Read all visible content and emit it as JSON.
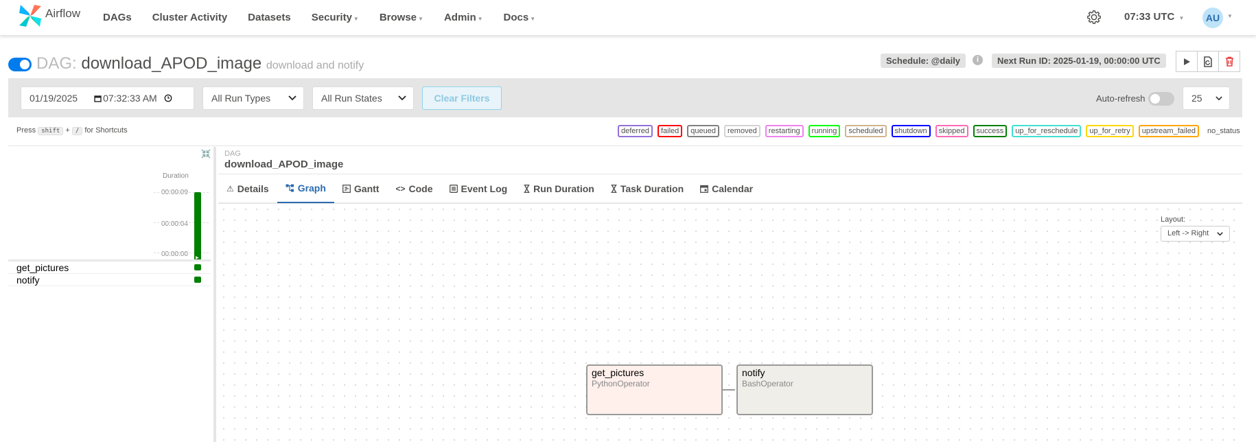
{
  "nav": {
    "brand": "Airflow",
    "items": [
      {
        "label": "DAGs",
        "caret": false
      },
      {
        "label": "Cluster Activity",
        "caret": false
      },
      {
        "label": "Datasets",
        "caret": false
      },
      {
        "label": "Security",
        "caret": true
      },
      {
        "label": "Browse",
        "caret": true
      },
      {
        "label": "Admin",
        "caret": true
      },
      {
        "label": "Docs",
        "caret": true
      }
    ],
    "time": "07:33 UTC",
    "avatar": "AU"
  },
  "dag": {
    "prefix": "DAG:",
    "id": "download_APOD_image",
    "description": "download and notify",
    "schedule": "Schedule: @daily",
    "next_run": "Next Run ID: 2025-01-19, 00:00:00 UTC",
    "paused": false
  },
  "filters": {
    "date": "01/19/2025",
    "time": "07:32:33 AM",
    "run_types": "All Run Types",
    "run_states": "All Run States",
    "clear_label": "Clear Filters",
    "autorefresh_label": "Auto-refresh",
    "autorefresh_on": false,
    "page_size": "25"
  },
  "shortcut": {
    "press": "Press",
    "key1": "shift",
    "plus": "+",
    "key2": "/",
    "suffix": "for Shortcuts"
  },
  "legend": [
    {
      "label": "deferred",
      "color": "#9370db"
    },
    {
      "label": "failed",
      "color": "#ff0000"
    },
    {
      "label": "queued",
      "color": "#808080"
    },
    {
      "label": "removed",
      "color": "#d3d3d3"
    },
    {
      "label": "restarting",
      "color": "#ee82ee"
    },
    {
      "label": "running",
      "color": "#00ff00"
    },
    {
      "label": "scheduled",
      "color": "#d2b48c"
    },
    {
      "label": "shutdown",
      "color": "#0000ff"
    },
    {
      "label": "skipped",
      "color": "#ff69b4"
    },
    {
      "label": "success",
      "color": "#008000"
    },
    {
      "label": "up_for_reschedule",
      "color": "#40e0d0"
    },
    {
      "label": "up_for_retry",
      "color": "#ffd700"
    },
    {
      "label": "upstream_failed",
      "color": "#ffa500"
    },
    {
      "label": "no_status",
      "color": "none"
    }
  ],
  "grid": {
    "duration_label": "Duration",
    "ticks": [
      "00:00:09",
      "00:00:04",
      "00:00:00"
    ],
    "run_duration_fraction": 1.0,
    "tasks": [
      {
        "name": "get_pictures",
        "state": "success"
      },
      {
        "name": "notify",
        "state": "success"
      }
    ]
  },
  "details": {
    "small_label": "DAG",
    "dag_id": "download_APOD_image",
    "tabs": [
      {
        "label": "Details",
        "icon": "warning-icon",
        "active": false
      },
      {
        "label": "Graph",
        "icon": "graph-icon",
        "active": true
      },
      {
        "label": "Gantt",
        "icon": "gantt-icon",
        "active": false
      },
      {
        "label": "Code",
        "icon": "code-icon",
        "active": false
      },
      {
        "label": "Event Log",
        "icon": "log-icon",
        "active": false
      },
      {
        "label": "Run Duration",
        "icon": "hourglass-icon",
        "active": false
      },
      {
        "label": "Task Duration",
        "icon": "hourglass-icon",
        "active": false
      },
      {
        "label": "Calendar",
        "icon": "calendar-icon",
        "active": false
      }
    ]
  },
  "graph": {
    "layout_label": "Layout:",
    "layout_value": "Left -> Right",
    "nodes": [
      {
        "name": "get_pictures",
        "operator": "PythonOperator",
        "bg": "#fff0ec"
      },
      {
        "name": "notify",
        "operator": "BashOperator",
        "bg": "#f0eee9"
      }
    ]
  }
}
